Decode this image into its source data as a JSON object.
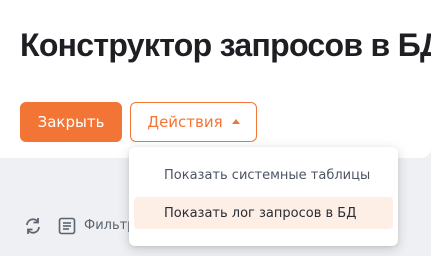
{
  "header": {
    "title": "Конструктор запросов в БД",
    "close_label": "Закрыть",
    "actions_label": "Действия"
  },
  "dropdown": {
    "items": [
      {
        "label": "Показать системные таблицы"
      },
      {
        "label": "Показать лог запросов в БД"
      }
    ]
  },
  "toolbar": {
    "filter_label": "Фильтр"
  },
  "colors": {
    "accent": "#f27535",
    "hover_bg": "#fdeee6",
    "background": "#eef0f3"
  }
}
